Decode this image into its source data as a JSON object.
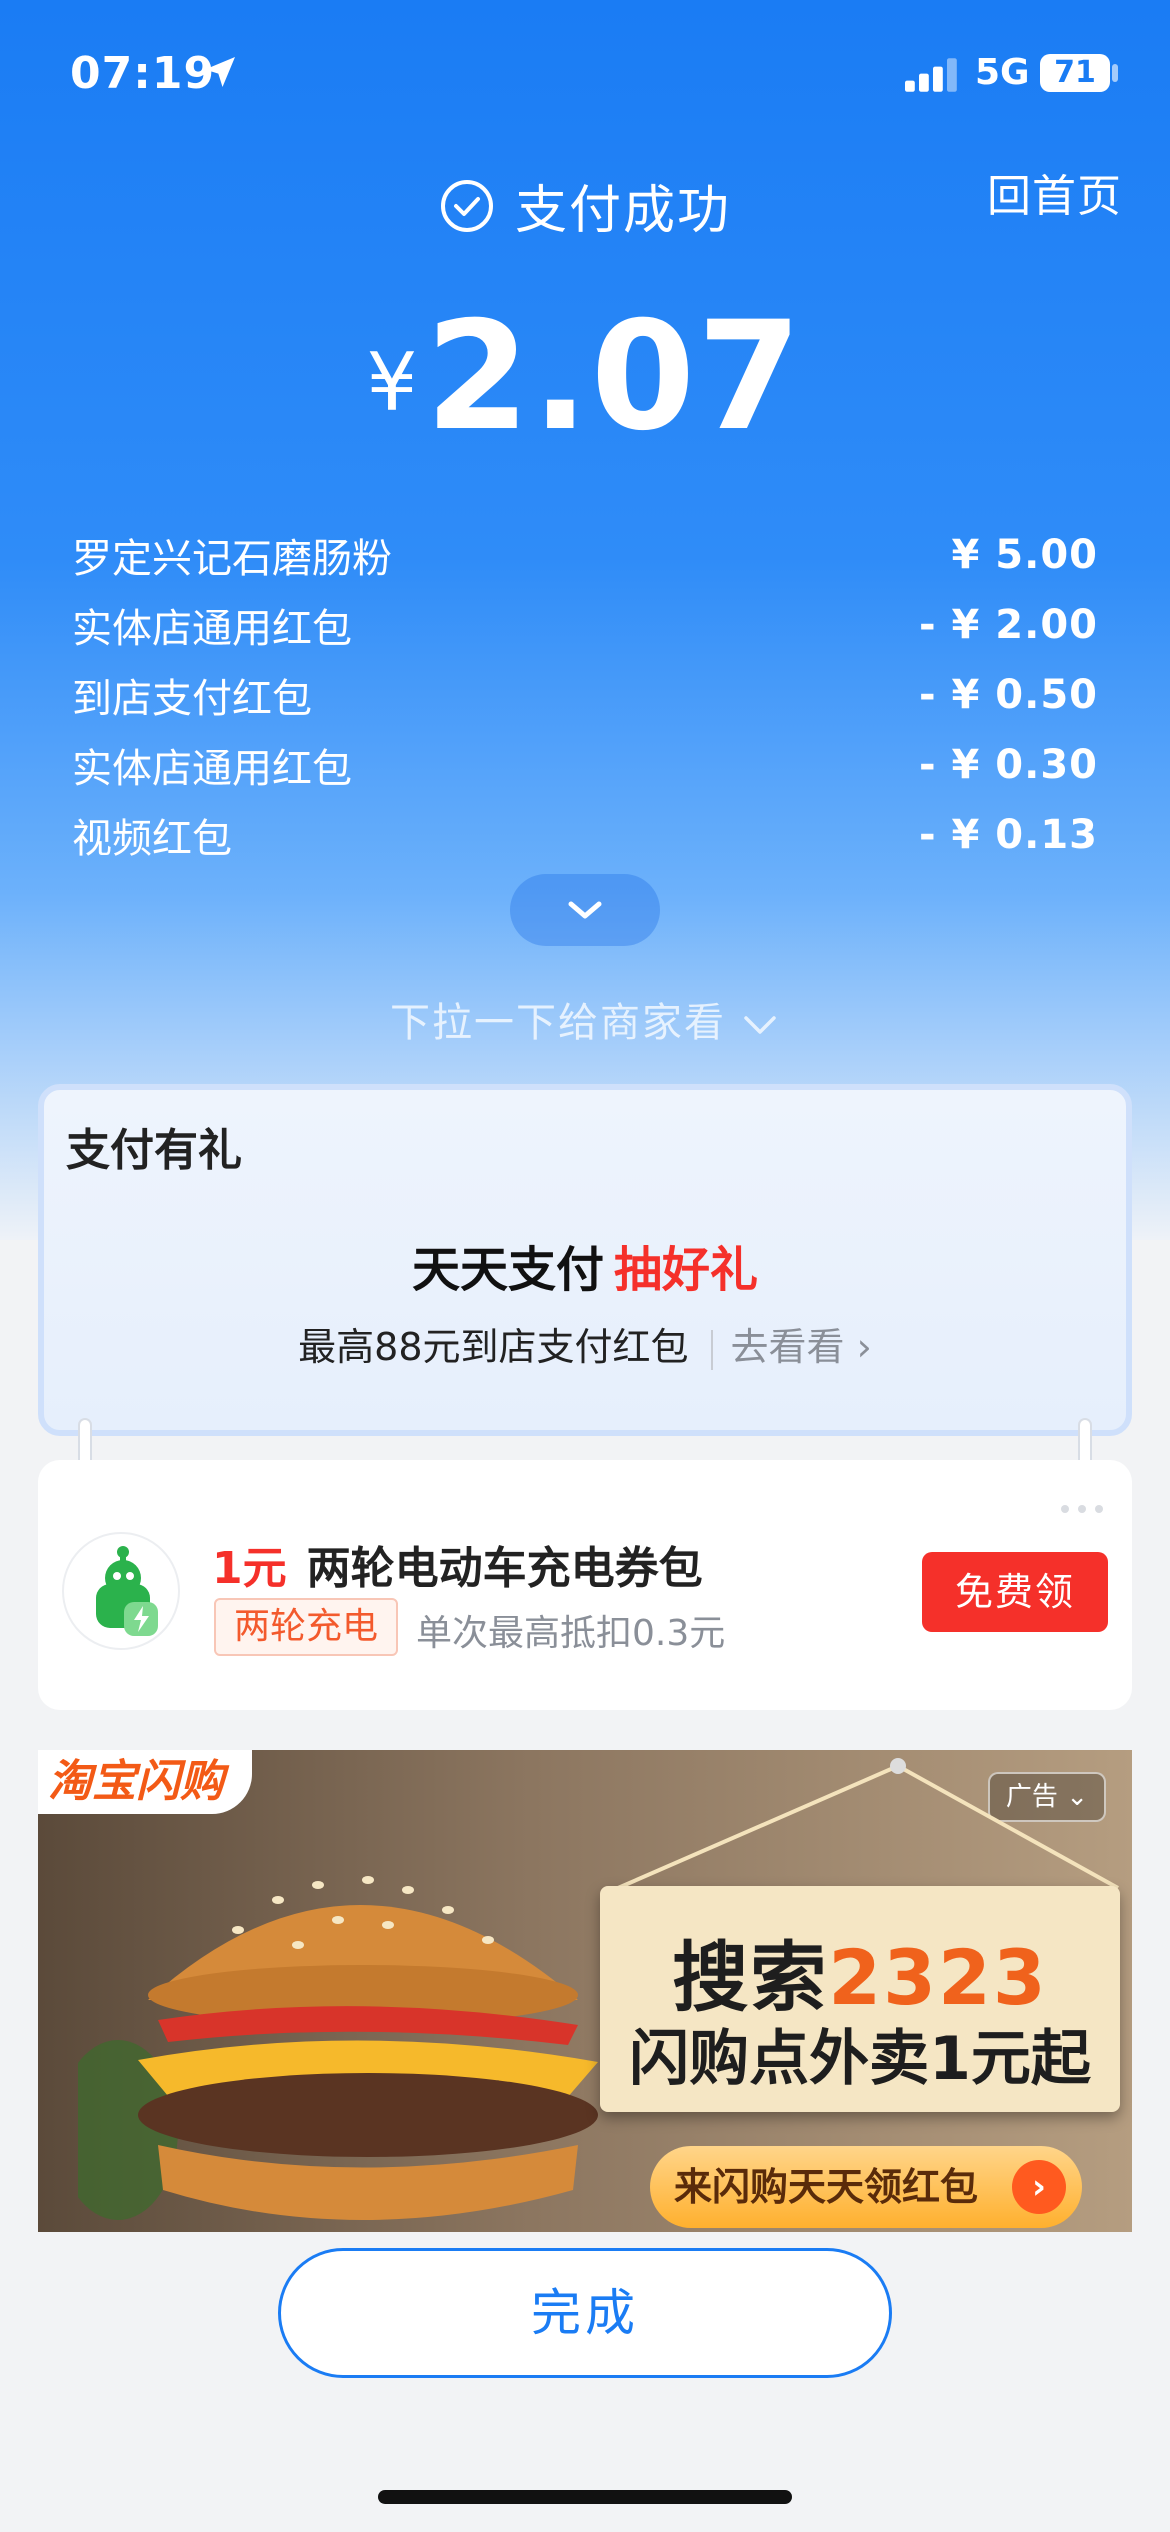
{
  "status_bar": {
    "time": "07:19",
    "network": "5G",
    "battery": "71",
    "icons": [
      "location-arrow-icon",
      "signal-icon"
    ]
  },
  "header": {
    "status_text": "支付成功",
    "home_link": "回首页",
    "currency": "¥",
    "amount": "2.07"
  },
  "details": [
    {
      "label": "罗定兴记石磨肠粉",
      "value": "¥ 5.00"
    },
    {
      "label": "实体店通用红包",
      "value": "- ¥ 2.00"
    },
    {
      "label": "到店支付红包",
      "value": "- ¥ 0.50"
    },
    {
      "label": "实体店通用红包",
      "value": "- ¥ 0.30"
    },
    {
      "label": "视频红包",
      "value": "- ¥ 0.13"
    }
  ],
  "pull_hint": "下拉一下给商家看",
  "gift": {
    "title": "支付有礼",
    "headline": "天天支付",
    "headline_highlight": "抽好礼",
    "subtitle": "最高88元到店支付红包",
    "go_link": "去看看"
  },
  "coupon": {
    "price": "1元",
    "title": "两轮电动车充电券包",
    "tag": "两轮充电",
    "desc": "单次最高抵扣0.3元",
    "button": "免费领"
  },
  "ad": {
    "brand": "淘宝闪购",
    "label": "广告",
    "line1_prefix": "搜索",
    "line1_number": "2323",
    "line2": "闪购点外卖1元起",
    "cta": "来闪购天天领红包"
  },
  "done_button": "完成",
  "colors": {
    "primary": "#1a7cf4",
    "accent_red": "#f5302a",
    "orange": "#f35a2d"
  }
}
